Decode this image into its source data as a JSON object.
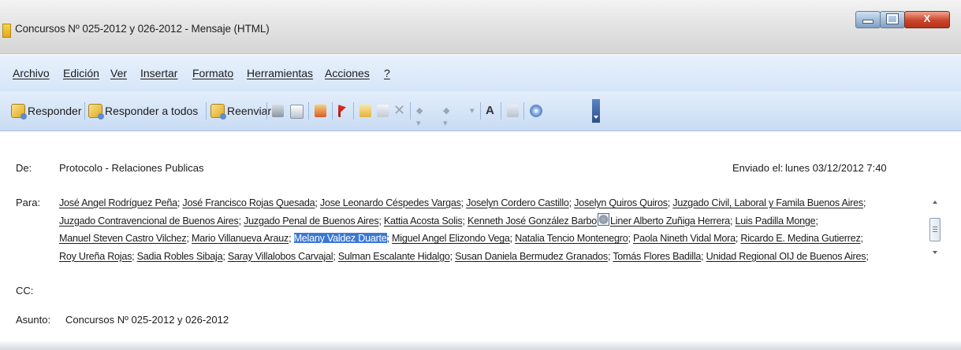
{
  "window": {
    "title": "Concursos Nº 025-2012 y 026-2012 - Mensaje (HTML)",
    "close_label": "X"
  },
  "menu": [
    "Archivo",
    "Edición",
    "Ver",
    "Insertar",
    "Formato",
    "Herramientas",
    "Acciones",
    "?"
  ],
  "toolbar": {
    "reply": "Responder",
    "reply_all": "Responder a todos",
    "forward": "Reenviar",
    "icons": [
      "print-icon",
      "copy-icon",
      "move-icon",
      "flag-icon",
      "contact-icon",
      "delete-icon",
      "previous-icon",
      "next-icon",
      "font-size-icon",
      "address-book-icon",
      "help-icon"
    ]
  },
  "message": {
    "from_label": "De:",
    "from_value": "Protocolo - Relaciones Publicas",
    "sent_label": "Enviado el:",
    "sent_value": "lunes 03/12/2012 7:40",
    "to_label": "Para:",
    "to_lines": [
      [
        "José Angel Rodríguez Peña",
        "José Francisco Rojas Quesada",
        "Jose Leonardo Céspedes Vargas",
        "Joselyn Cordero Castillo",
        "Joselyn Quiros Quiros",
        "Juzgado Civil, Laboral y Famila Buenos Aires"
      ],
      [
        "Juzgado Contravencional de Buenos Aires",
        "Juzgado Penal de Buenos Aires",
        "Kattia Acosta Solis",
        "Kenneth José González Barbo",
        "Liner Alberto Zuñiga Herrera",
        "Luis Padilla Monge"
      ],
      [
        "Manuel Steven Castro Vilchez",
        "Mario Villanueva Arauz",
        "Melany Valdez Duarte",
        "Miguel Angel Elizondo Vega",
        "Natalia Tencio Montenegro",
        "Paola Nineth Vidal Mora",
        "Ricardo E. Medina Gutierrez"
      ],
      [
        "Roy Ureña Rojas",
        "Sadia Robles Sibaja",
        "Saray Villalobos Carvajal",
        "Sulman Escalante Hidalgo",
        "Susan Daniela Bermudez Granados",
        "Tomás Flores Badilla",
        "Unidad Regional OIJ de Buenos Aires"
      ]
    ],
    "selected_recipient": "Melany Valdez Duarte",
    "cc_label": "CC:",
    "subject_label": "Asunto:",
    "subject_value": "Concursos Nº 025-2012 y 026-2012"
  },
  "colors": {
    "selection": "#3a78d6",
    "menubar": "#d6e5f8",
    "close_button": "#c9452b"
  }
}
